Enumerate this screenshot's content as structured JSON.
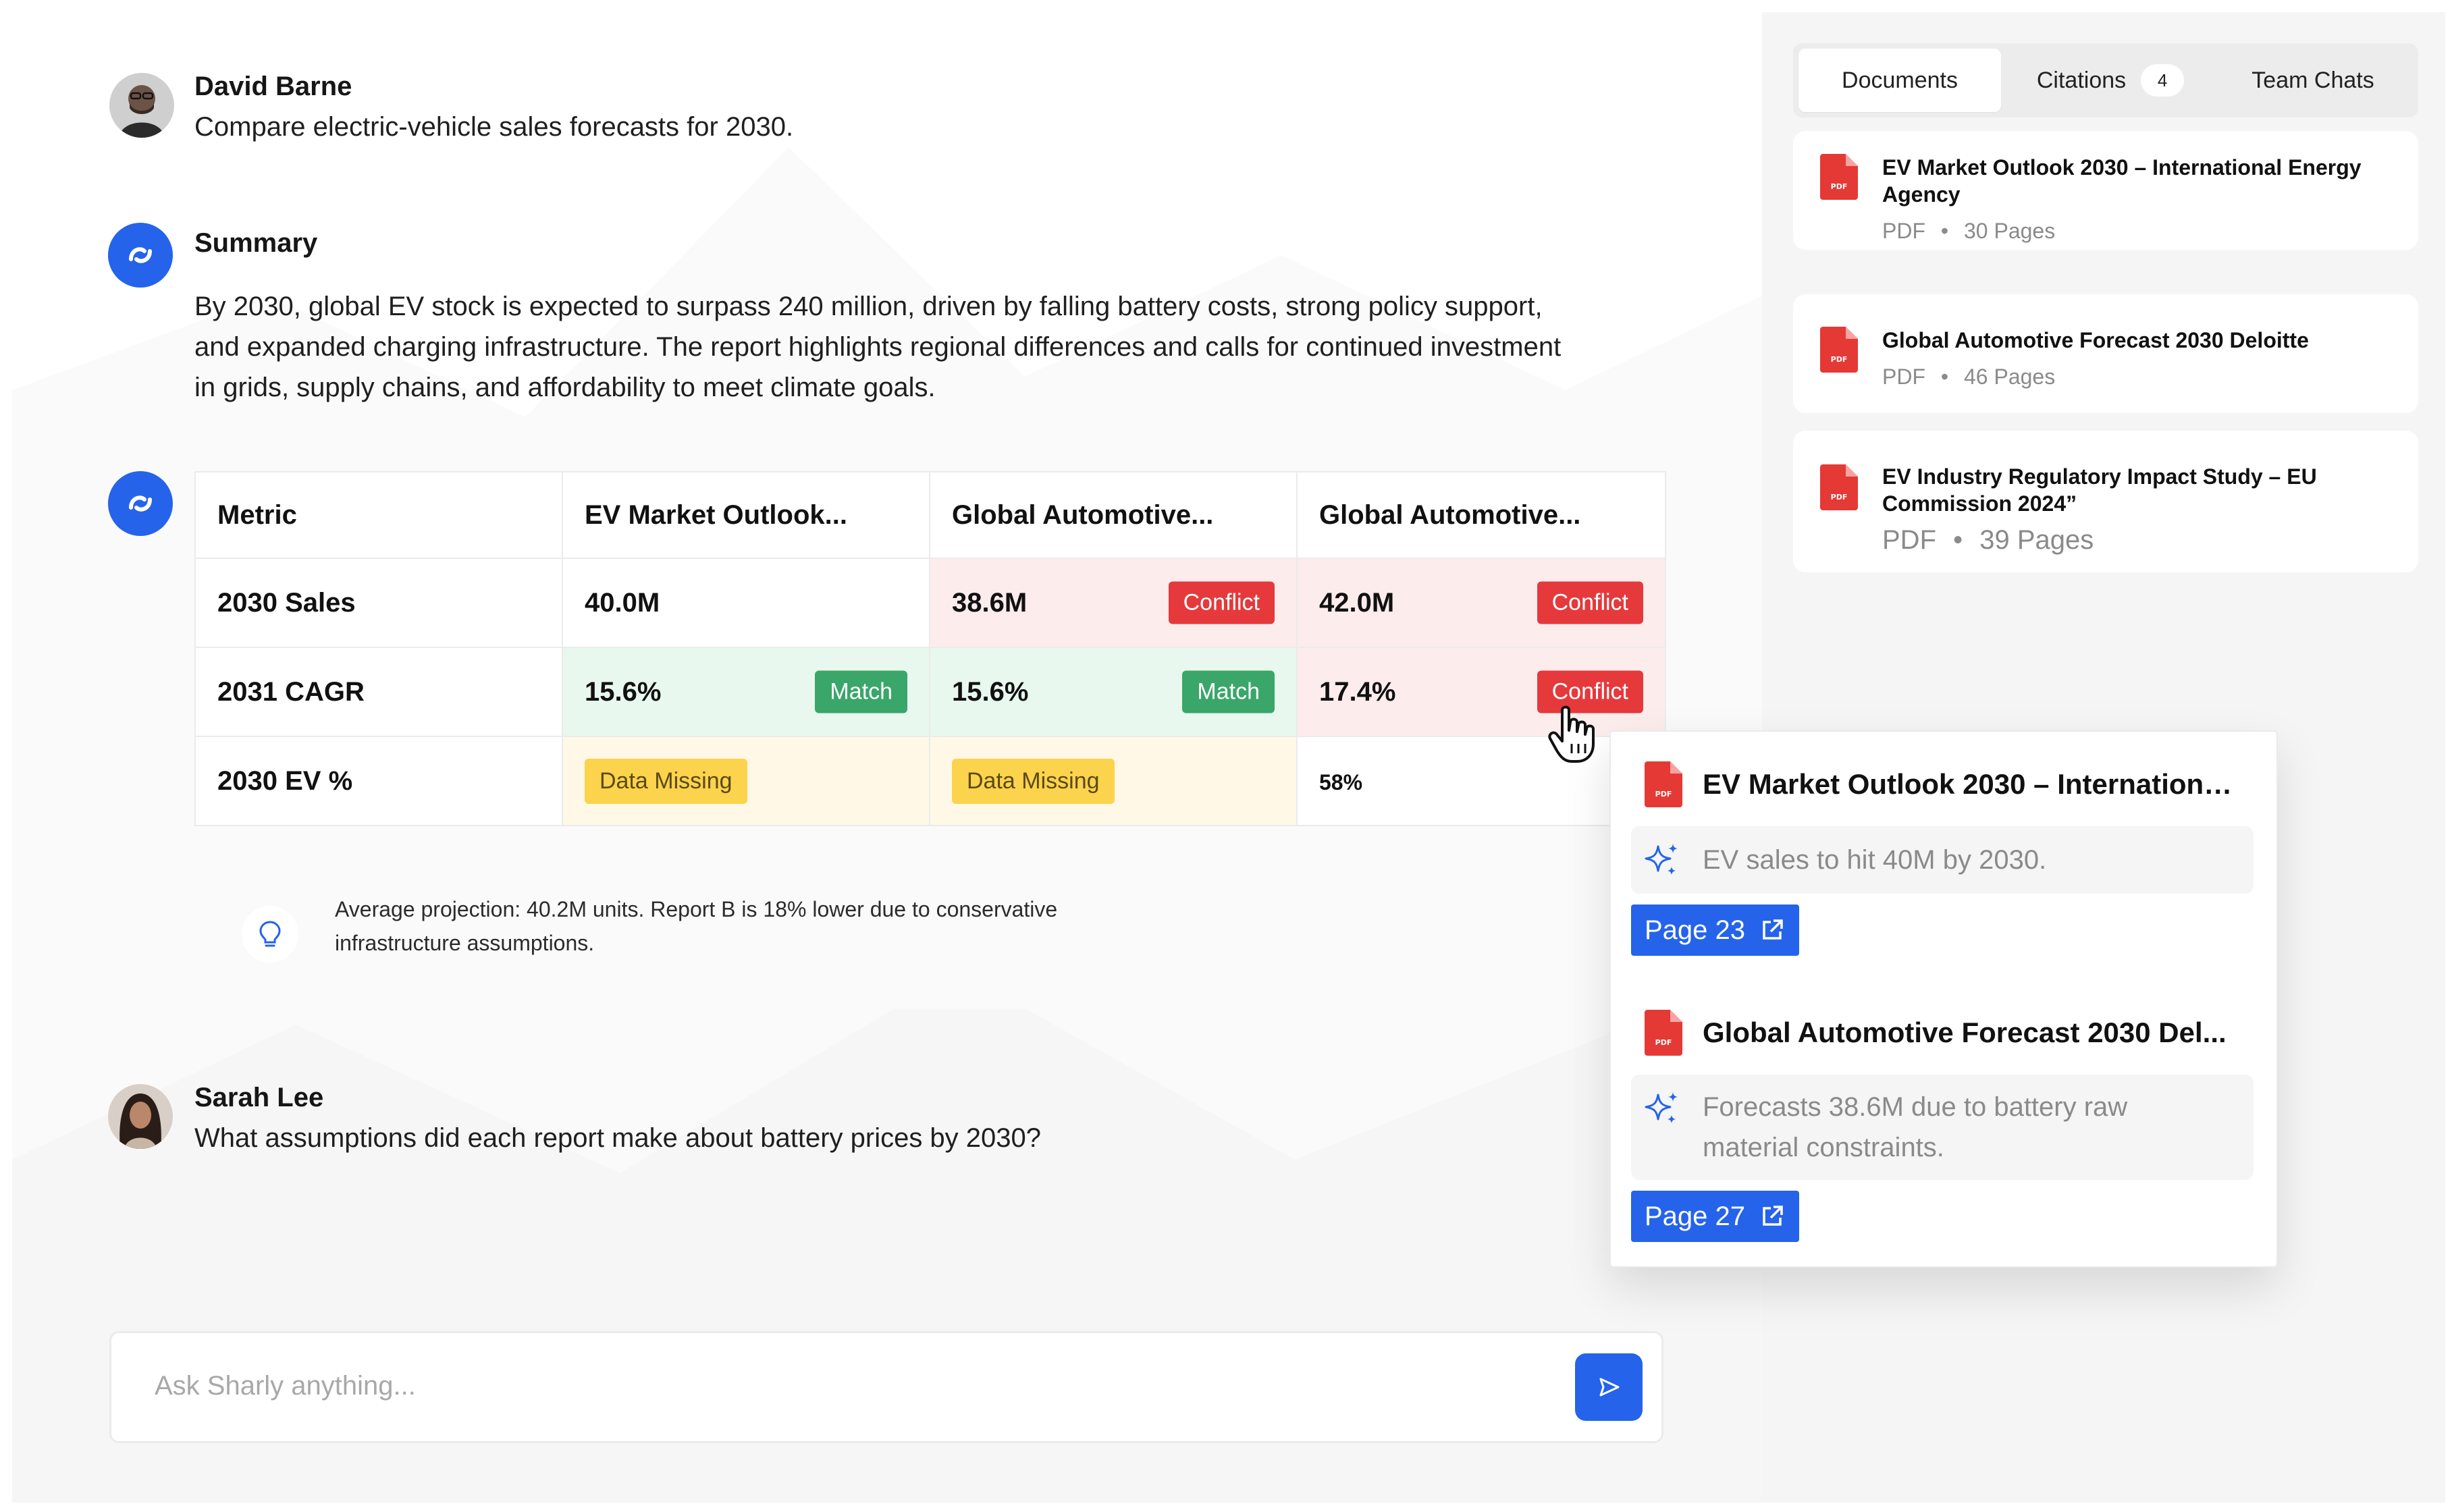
{
  "conversation": {
    "user1": {
      "name": "David Barne",
      "message": "Compare electric-vehicle sales forecasts for 2030."
    },
    "summary": {
      "title": "Summary",
      "lines": [
        "By 2030, global EV stock is expected to surpass 240 million, driven by falling battery costs, strong policy support,",
        "and expanded charging infrastructure. The report highlights regional differences and calls for continued investment",
        "in grids, supply chains, and affordability to meet climate goals."
      ]
    },
    "user2": {
      "name": "Sarah Lee",
      "message": "What assumptions did each report make about battery prices by 2030?"
    }
  },
  "comparison_table": {
    "headers": [
      "Metric",
      "EV Market Outlook...",
      "Global Automotive...",
      "Global Automotive..."
    ],
    "rows": [
      {
        "metric": "2030 Sales",
        "cells": [
          {
            "value": "40.0M",
            "status": ""
          },
          {
            "value": "38.6M",
            "status": "Conflict"
          },
          {
            "value": "42.0M",
            "status": "Conflict"
          }
        ]
      },
      {
        "metric": "2031 CAGR",
        "cells": [
          {
            "value": "15.6%",
            "status": "Match"
          },
          {
            "value": "15.6%",
            "status": "Match"
          },
          {
            "value": "17.4%",
            "status": "Conflict"
          }
        ]
      },
      {
        "metric": "2030 EV %",
        "cells": [
          {
            "value": "",
            "status": "Data Missing"
          },
          {
            "value": "",
            "status": "Data Missing"
          },
          {
            "value": "58%",
            "status": ""
          }
        ]
      }
    ]
  },
  "insight": {
    "line1": "Average projection: 40.2M units. Report B is 18% lower due to conservative",
    "line2": "infrastructure assumptions."
  },
  "composer": {
    "placeholder": "Ask Sharly anything..."
  },
  "side_panel": {
    "tabs": [
      {
        "label": "Documents",
        "active": true
      },
      {
        "label": "Citations",
        "count": "4"
      },
      {
        "label": "Team Chats"
      }
    ],
    "documents": [
      {
        "title_line1": "EV Market Outlook 2030 – International Energy",
        "title_line2": "Agency",
        "type": "PDF",
        "pages": "30 Pages"
      },
      {
        "title_line1": "Global Automotive Forecast 2030  Deloitte",
        "title_line2": "",
        "type": "PDF",
        "pages": "46 Pages"
      },
      {
        "title_line1": "EV Industry Regulatory Impact Study – EU",
        "title_line2": "Commission 2024”",
        "type": "PDF",
        "pages": "39 Pages"
      }
    ]
  },
  "citation_popover": {
    "items": [
      {
        "title": "EV Market Outlook 2030 – International...",
        "quote_line1": "EV sales to hit 40M by 2030.",
        "quote_line2": "",
        "page": "Page 23"
      },
      {
        "title": "Global Automotive Forecast 2030  Del...",
        "quote_line1": "Forecasts 38.6M due to battery raw",
        "quote_line2": "material constraints.",
        "page": "Page 27"
      }
    ]
  },
  "colors": {
    "accent": "#2563eb",
    "conflict": "#e5393c",
    "match": "#3aa66a",
    "missing": "#fcd34d",
    "pdf": "#e53935"
  }
}
